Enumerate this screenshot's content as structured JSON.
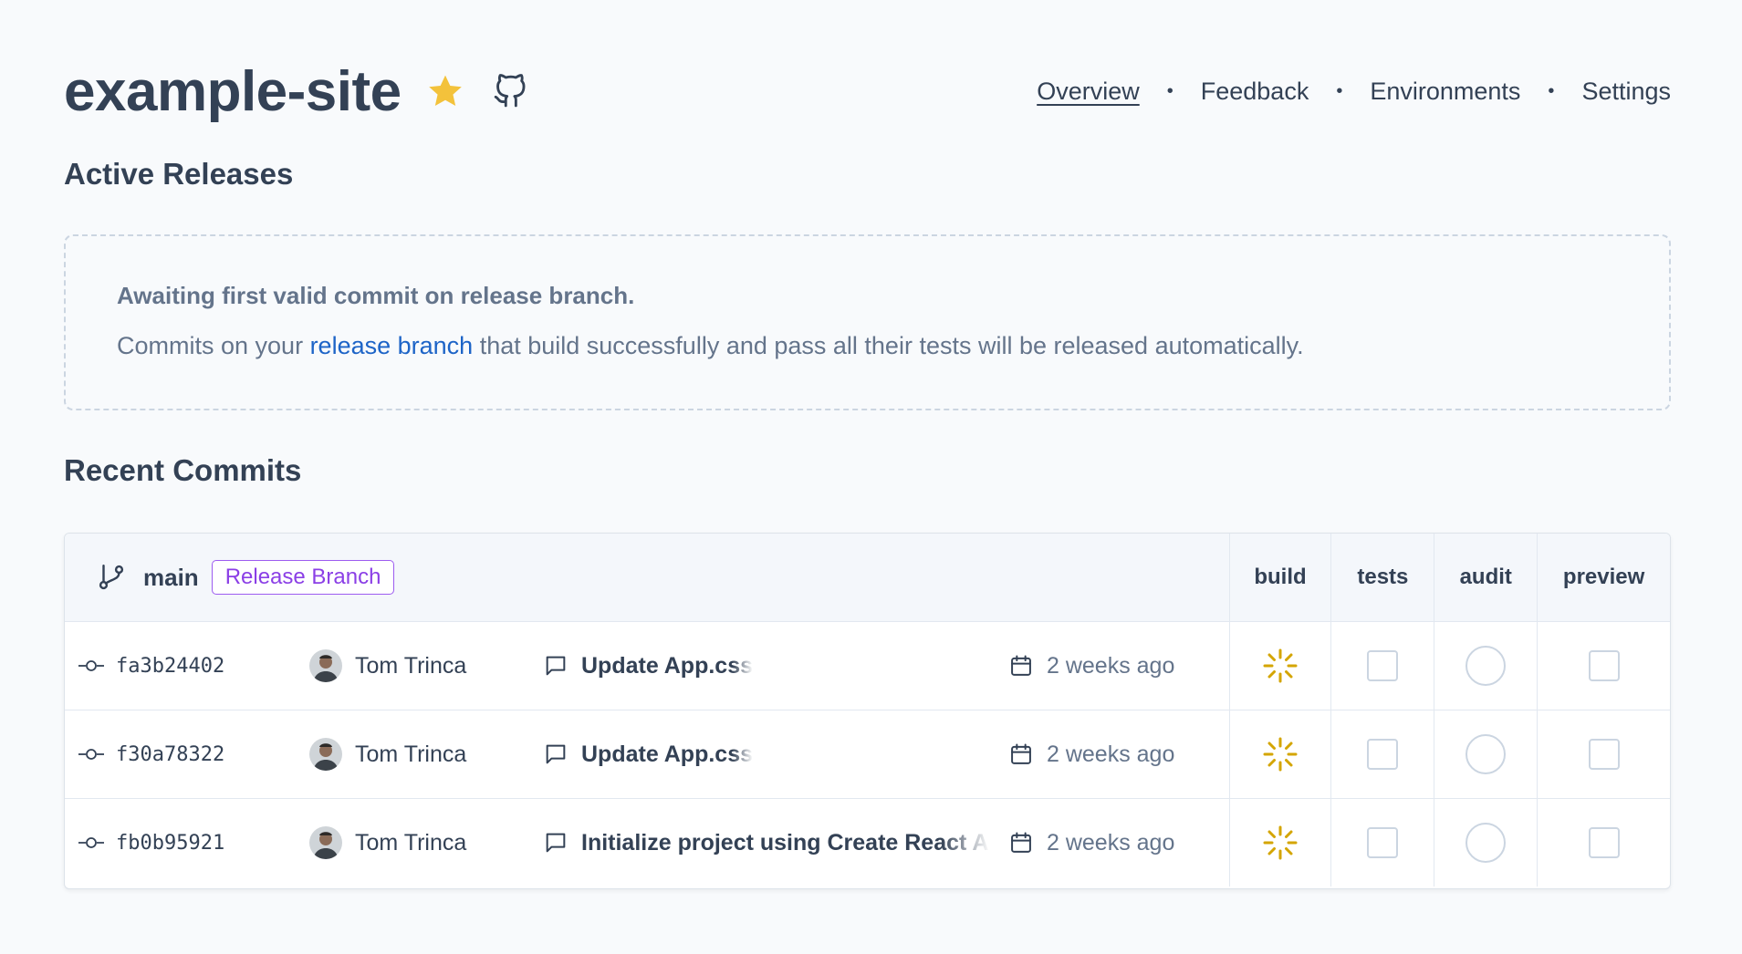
{
  "project": {
    "name": "example-site"
  },
  "nav": {
    "items": [
      {
        "label": "Overview",
        "active": true
      },
      {
        "label": "Feedback",
        "active": false
      },
      {
        "label": "Environments",
        "active": false
      },
      {
        "label": "Settings",
        "active": false
      }
    ],
    "separator": "•"
  },
  "active_releases": {
    "title": "Active Releases",
    "notice": {
      "heading": "Awaiting first valid commit on release branch.",
      "body_prefix": "Commits on your ",
      "link_text": "release branch",
      "body_suffix": " that build successfully and pass all their tests will be released automatically."
    }
  },
  "recent_commits": {
    "title": "Recent Commits",
    "branch": {
      "name": "main",
      "badge": "Release Branch",
      "badge_color": "#8b3fe6"
    },
    "columns": [
      "build",
      "tests",
      "audit",
      "preview"
    ],
    "rows": [
      {
        "sha": "fa3b24402",
        "author": "Tom Trinca",
        "message": "Update App.css",
        "date": "2 weeks ago",
        "build": "in-progress",
        "tests": "pending",
        "audit": "pending",
        "preview": "pending"
      },
      {
        "sha": "f30a78322",
        "author": "Tom Trinca",
        "message": "Update App.css",
        "date": "2 weeks ago",
        "build": "in-progress",
        "tests": "pending",
        "audit": "pending",
        "preview": "pending"
      },
      {
        "sha": "fb0b95921",
        "author": "Tom Trinca",
        "message": "Initialize project using Create React App",
        "date": "2 weeks ago",
        "build": "in-progress",
        "tests": "pending",
        "audit": "pending",
        "preview": "pending"
      }
    ]
  },
  "colors": {
    "text": "#334155",
    "muted": "#64748b",
    "link": "#1d64c7",
    "star": "#f3c23b",
    "spinner": "#d4a500",
    "border": "#cbd5e1"
  },
  "icons": [
    "star-icon",
    "github-icon",
    "git-branch-icon",
    "git-commit-icon",
    "message-icon",
    "calendar-icon",
    "spinner-icon"
  ]
}
